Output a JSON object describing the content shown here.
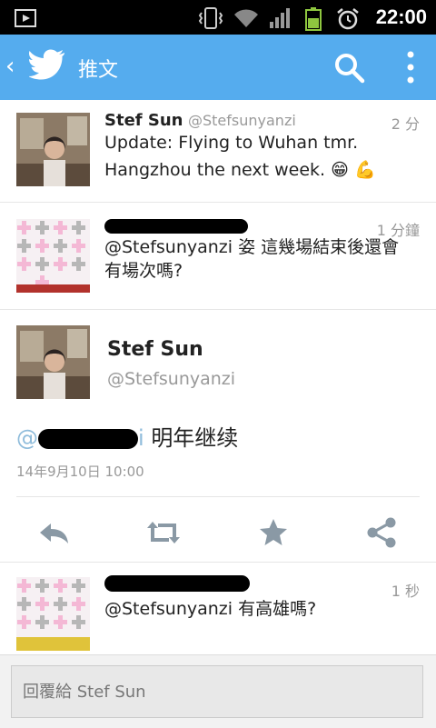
{
  "status_bar": {
    "time": "22:00",
    "icons": [
      "image-icon",
      "vibrate-icon",
      "wifi-icon",
      "signal-icon",
      "battery-icon",
      "alarm-icon"
    ]
  },
  "app_bar": {
    "title": "推文",
    "icons": [
      "back-icon",
      "twitter-bird-icon",
      "search-icon",
      "overflow-menu-icon"
    ],
    "color": "#55acee"
  },
  "tweets": [
    {
      "name": "Stef Sun",
      "handle": "@Stefsunyanzi",
      "time": "2 分",
      "text_line1": "Update: Flying to Wuhan tmr.",
      "text_line2": "Hangzhou the next week. 😁 💪"
    },
    {
      "time": "1 分鐘",
      "text_line1": "@Stefsunyanzi 姿 這幾場結束後還會",
      "text_line2": "有場次嗎?"
    },
    {
      "time": "1 秒",
      "text": "@Stefsunyanzi 有高雄嗎?"
    }
  ],
  "focus": {
    "name": "Stef Sun",
    "handle": "@Stefsunyanzi",
    "mention_visible": "@",
    "mention_tail": "i",
    "text": "明年继续",
    "date": "14年9月10日 10:00",
    "actions": [
      "reply-icon",
      "retweet-icon",
      "favorite-icon",
      "share-icon"
    ]
  },
  "reply": {
    "placeholder": "回覆給 Stef Sun"
  }
}
